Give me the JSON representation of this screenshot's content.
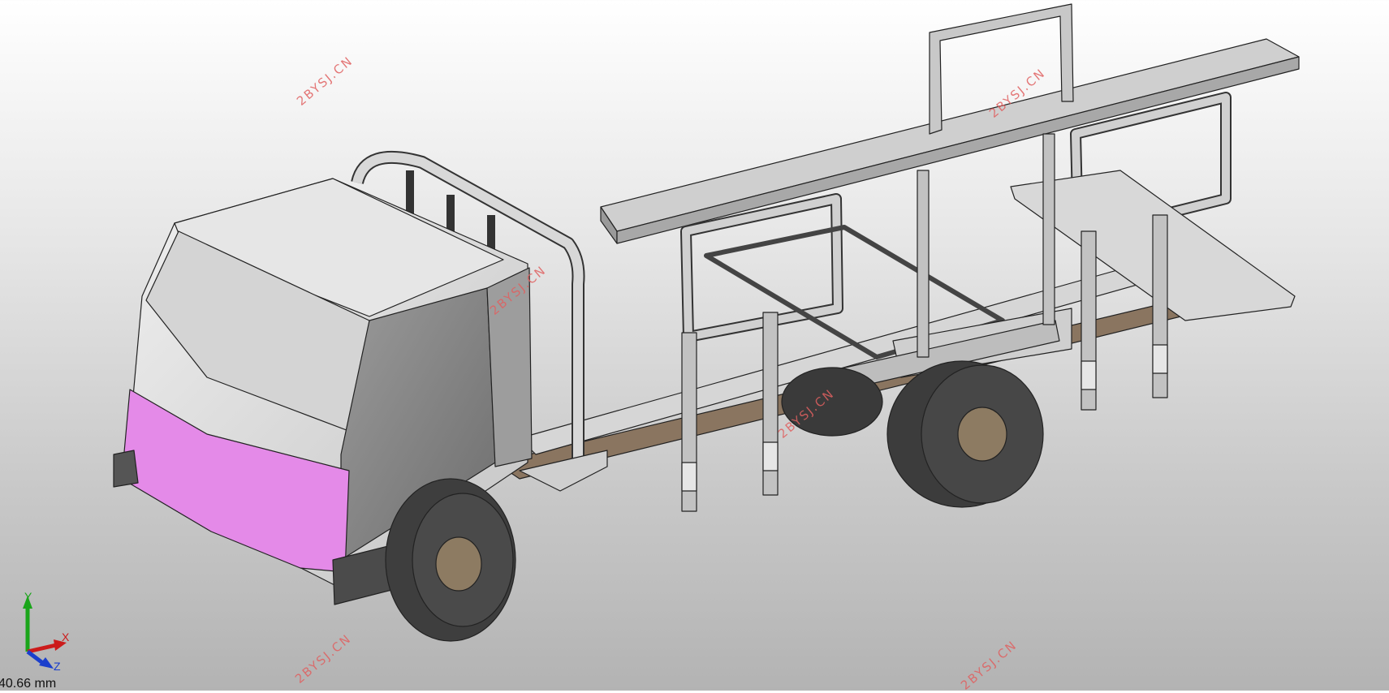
{
  "viewport": {
    "scale_readout": "40.66 mm",
    "highlight_color": "#e48ae8",
    "background_color": "#d8d8d8"
  },
  "axes": {
    "x": "X",
    "y": "Y",
    "z": "Z"
  },
  "watermarks": [
    "2BYSJ.CN",
    "2BYSJ.CN",
    "2BYSJ.CN",
    "2BYSJ.CN",
    "2BYSJ.CN",
    "2BYSJ.CN",
    "2BYSJ.CN"
  ]
}
